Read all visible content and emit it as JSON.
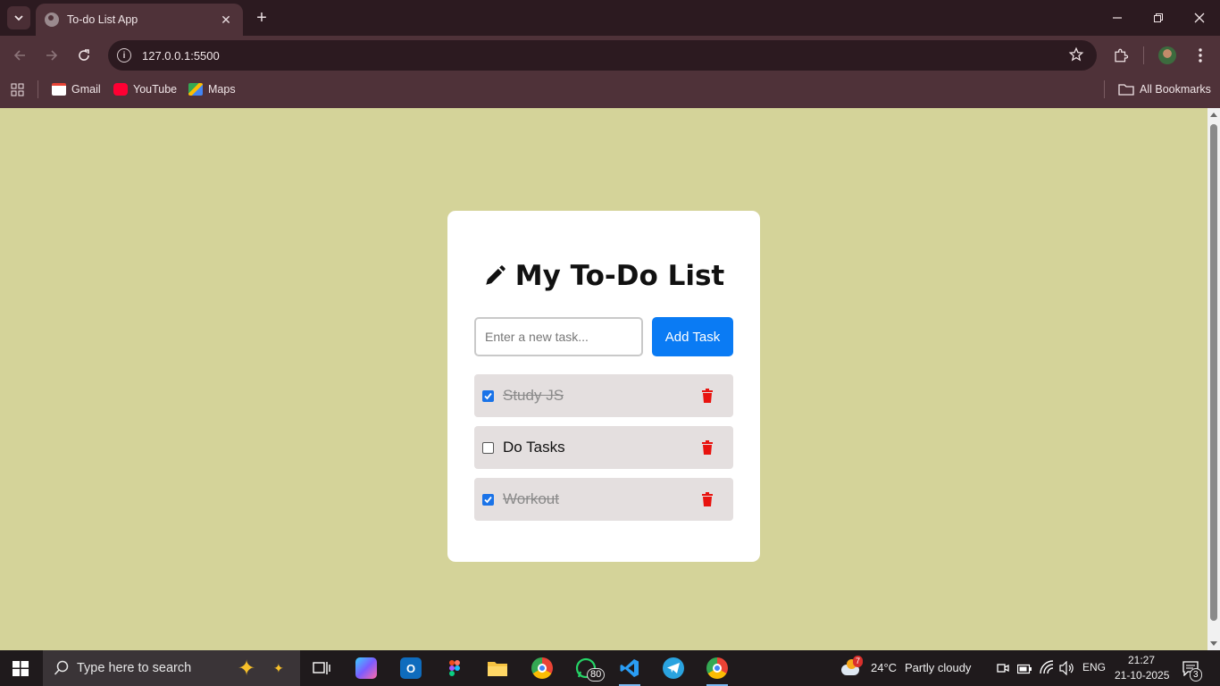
{
  "browser": {
    "tab_title": "To-do List App",
    "url": "127.0.0.1:5500",
    "bookmarks": [
      {
        "label": "Gmail",
        "color": "#e84335"
      },
      {
        "label": "YouTube",
        "color": "#ff0033"
      },
      {
        "label": "Maps",
        "color": "#34a853"
      }
    ],
    "all_bookmarks": "All Bookmarks"
  },
  "app": {
    "title": "My To-Do List",
    "input_placeholder": "Enter a new task...",
    "add_button": "Add Task",
    "tasks": [
      {
        "label": "Study JS",
        "done": true
      },
      {
        "label": "Do Tasks",
        "done": false
      },
      {
        "label": "Workout",
        "done": true
      }
    ],
    "colors": {
      "page_bg": "#d4d399",
      "accent": "#0a7bf4",
      "delete": "#e8130f"
    }
  },
  "taskbar": {
    "search_placeholder": "Type here to search",
    "weather": {
      "badge": "7",
      "temp": "24°C",
      "condition": "Partly cloudy"
    },
    "language": "ENG",
    "time": "21:27",
    "date": "21-10-2025",
    "whatsapp_badge": "80",
    "notification_count": "3"
  }
}
